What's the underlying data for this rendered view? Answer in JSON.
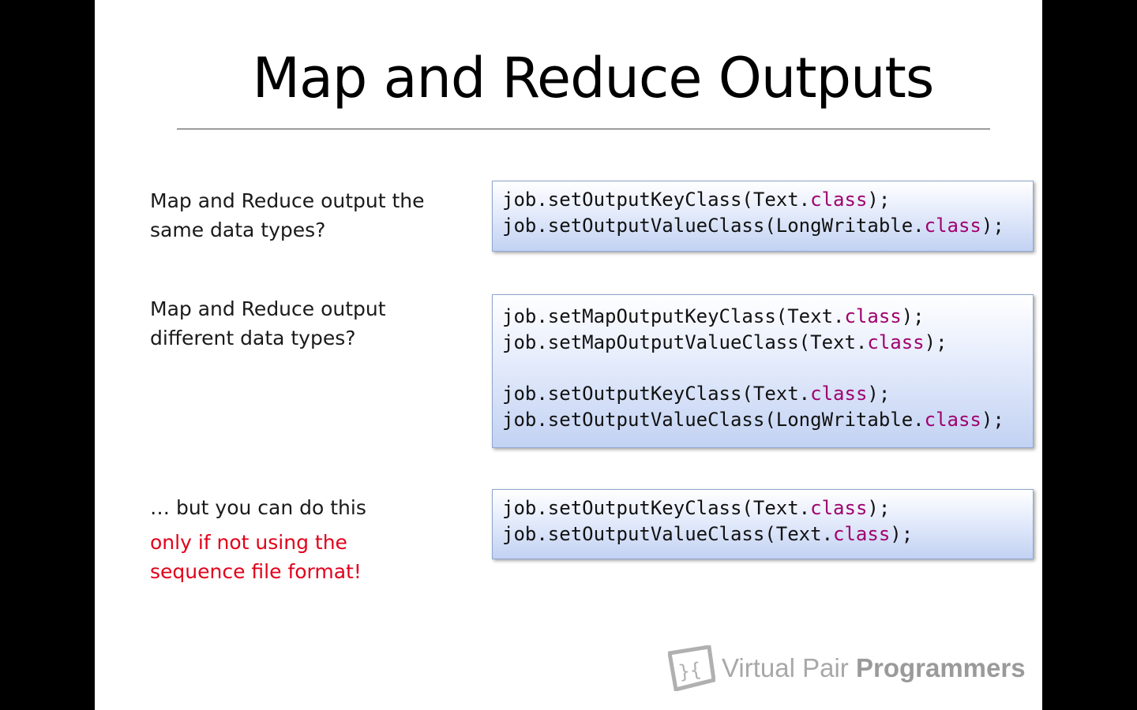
{
  "slide": {
    "title": "Map and Reduce Outputs"
  },
  "sections": [
    {
      "prompt": "Map and Reduce output the\nsame data types?",
      "code": [
        [
          "job.setOutputKeyClass(Text.",
          "class",
          ");"
        ],
        [
          "job.setOutputValueClass(LongWritable.",
          "class",
          ");"
        ]
      ]
    },
    {
      "prompt": "Map and Reduce output\ndifferent data types?",
      "code": [
        [
          "job.setMapOutputKeyClass(Text.",
          "class",
          ");"
        ],
        [
          "job.setMapOutputValueClass(Text.",
          "class",
          ");"
        ],
        [],
        [
          "job.setOutputKeyClass(Text.",
          "class",
          ");"
        ],
        [
          "job.setOutputValueClass(LongWritable.",
          "class",
          ");"
        ]
      ]
    },
    {
      "prompt": "… but you can do this",
      "warning": "only if not using the\nsequence file format!",
      "code": [
        [
          "job.setOutputKeyClass(Text.",
          "class",
          ");"
        ],
        [
          "job.setOutputValueClass(Text.",
          "class",
          ");"
        ]
      ]
    }
  ],
  "logo": {
    "text_light": "Virtual Pair ",
    "text_bold": "Programmers",
    "icon": "code-braces-logo-icon"
  },
  "colors": {
    "keyword": "#a0006e",
    "warning": "#e2001a",
    "code_box_top": "#ffffff",
    "code_box_bottom": "#c2d2f3"
  }
}
